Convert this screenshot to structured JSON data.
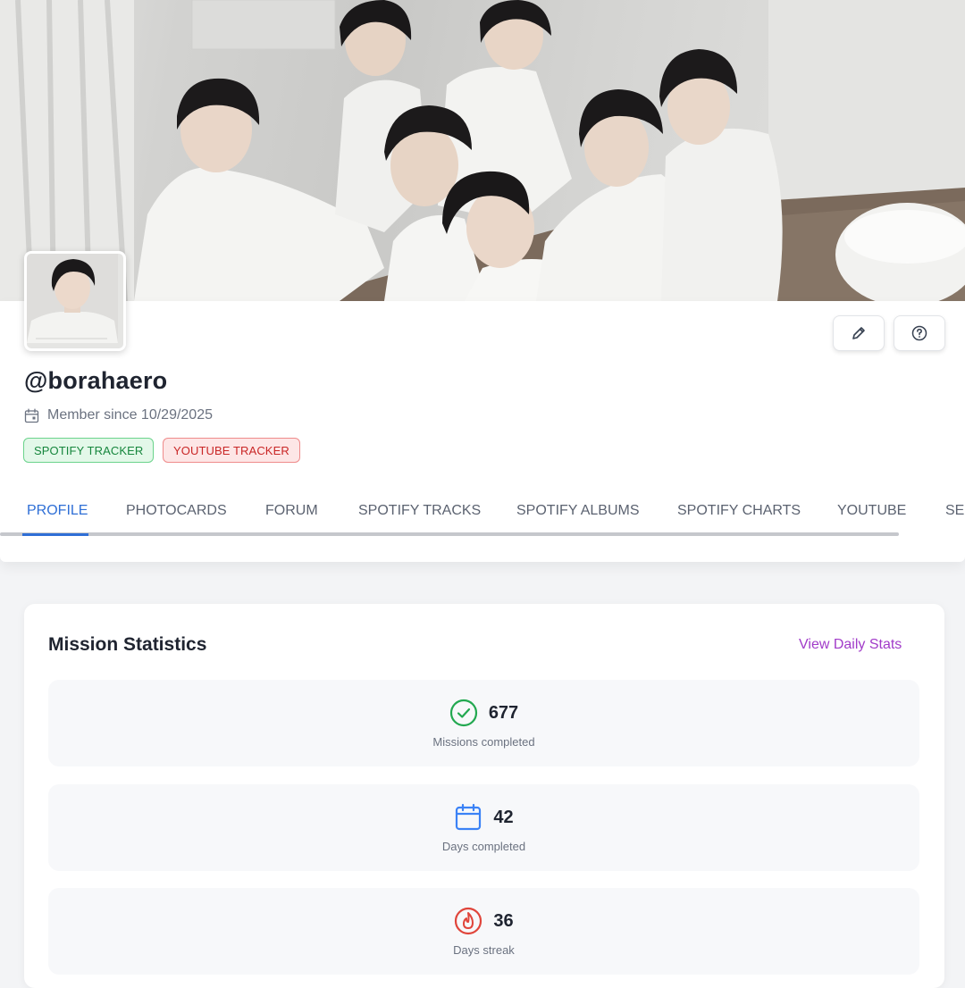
{
  "cover": {
    "image": "group-photo-banner"
  },
  "profile": {
    "username": "@borahaero",
    "member_since": "Member since 10/29/2025",
    "avatar": "profile-avatar-photo",
    "badges": [
      {
        "label": "SPOTIFY TRACKER",
        "color": "#16863d"
      },
      {
        "label": "YOUTUBE TRACKER",
        "color": "#c92626"
      }
    ]
  },
  "actions": {
    "edit_icon": "pencil-icon",
    "help_icon": "question-circle-icon"
  },
  "tabs": [
    {
      "label": "PROFILE",
      "active": true
    },
    {
      "label": "PHOTOCARDS"
    },
    {
      "label": "FORUM"
    },
    {
      "label": "SPOTIFY TRACKS"
    },
    {
      "label": "SPOTIFY ALBUMS"
    },
    {
      "label": "SPOTIFY CHARTS"
    },
    {
      "label": "YOUTUBE"
    },
    {
      "label": "SE"
    }
  ],
  "mission_stats": {
    "title": "Mission Statistics",
    "link": "View Daily Stats",
    "items": [
      {
        "value": "677",
        "label": "Missions completed",
        "icon": "check-circle-icon",
        "color": "#22a850"
      },
      {
        "value": "42",
        "label": "Days completed",
        "icon": "calendar-icon",
        "color": "#3b82f6"
      },
      {
        "value": "36",
        "label": "Days streak",
        "icon": "flame-icon",
        "color": "#e0453b"
      }
    ]
  },
  "colors": {
    "accent": "#2f6fd6",
    "link": "#a13bc9"
  }
}
